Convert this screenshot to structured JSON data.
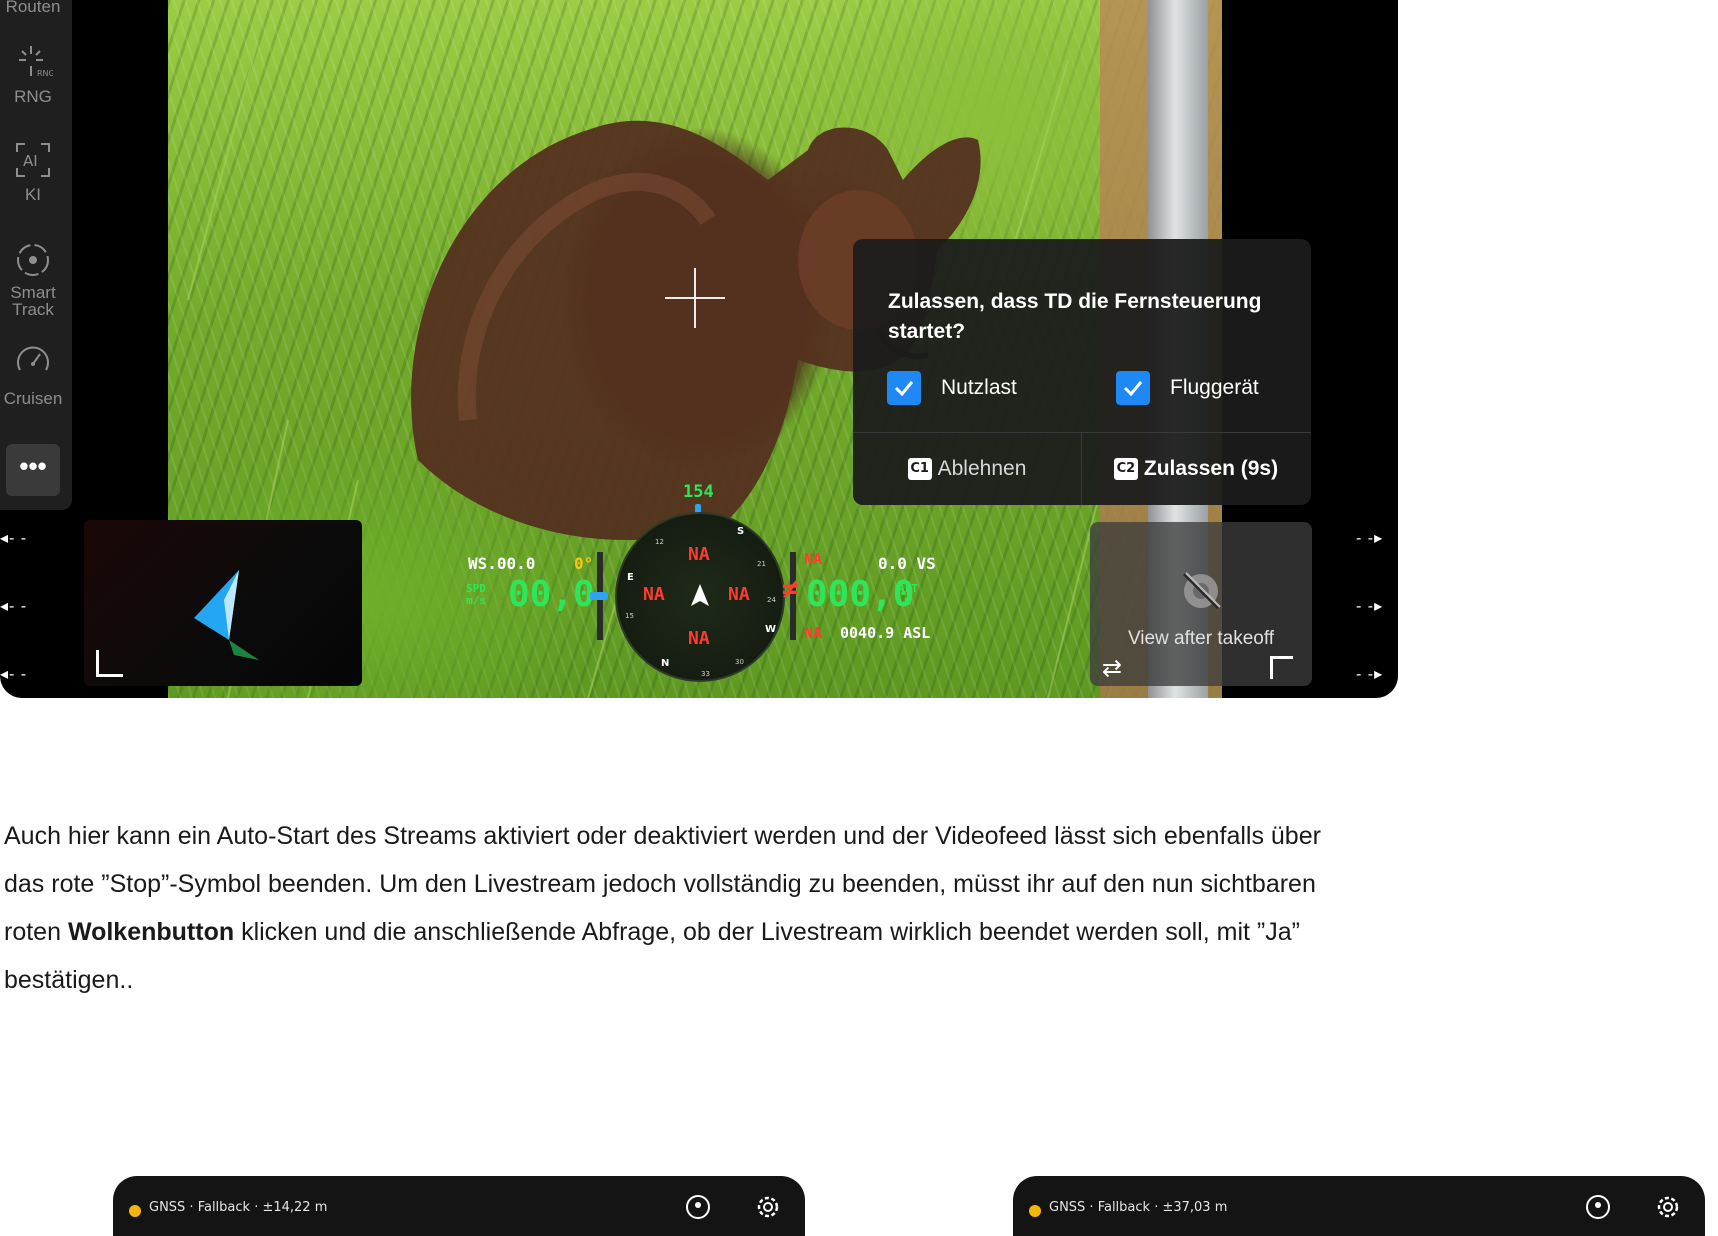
{
  "toolbar": {
    "items": [
      {
        "label": "Routen",
        "icon": "route-icon"
      },
      {
        "label": "RNG",
        "icon": "rng-icon"
      },
      {
        "label": "KI",
        "icon": "ai-icon"
      },
      {
        "label": "Smart Track",
        "icon": "smart-track-icon"
      },
      {
        "label": "Cruisen",
        "icon": "cruise-speedometer-icon"
      }
    ],
    "more_label": "•••"
  },
  "side_indicators": {
    "value": "- -"
  },
  "hud": {
    "heading": "154",
    "wind": "WS.00.0",
    "gimbal_angle": "0°",
    "speed_unit_top": "SPD",
    "speed_unit_bottom": "m/s",
    "speed": "00,0",
    "compass_n": "NA",
    "compass_w": "NA",
    "compass_e": "NA",
    "compass_s": "NA",
    "compass_labels": {
      "e": "E",
      "s": "S",
      "w": "W",
      "n": "N",
      "n12": "12",
      "n15": "15",
      "n21": "21",
      "n24": "24",
      "n30": "30",
      "n33": "33"
    },
    "vs": "0.0 VS",
    "altitude": "000,0",
    "alt_unit_top": "ALT",
    "alt_unit_bottom": "m",
    "na_top": "NA",
    "na_bottom": "NA",
    "asl": "0040.9 ASL",
    "colors": {
      "speed": "#2ee65a",
      "na": "#ff3b30",
      "heading": "#2ee65a",
      "gimbal": "#f5c518"
    }
  },
  "dialog": {
    "title": "Zulassen, dass TD die Fernsteuerung startet?",
    "option_payload": "Nutzlast",
    "option_aircraft": "Fluggerät",
    "reject_key": "C1",
    "reject_label": "Ablehnen",
    "allow_key": "C2",
    "allow_label": "Zulassen (9s)",
    "checkbox_color": "#1e88f5"
  },
  "preview": {
    "text": "View after takeoff"
  },
  "article": {
    "text_before_bold": "Auch hier kann ein Auto-Start des Streams aktiviert oder deaktiviert werden und der Videofeed lässt sich ebenfalls über das rote ”Stop”-Symbol beenden. Um den Livestream jedoch vollständig zu beenden, müsst ihr auf den nun sichtbaren roten ",
    "bold": "Wolkenbutton",
    "text_after_bold": " klicken und die anschließende Abfrage, ob der Livestream wirklich beendet werden soll, mit ”Ja” bestätigen.."
  },
  "cards": [
    {
      "gnss": "GNSS · Fallback · ±14,22 m"
    },
    {
      "gnss": "GNSS · Fallback · ±37,03 m"
    }
  ]
}
